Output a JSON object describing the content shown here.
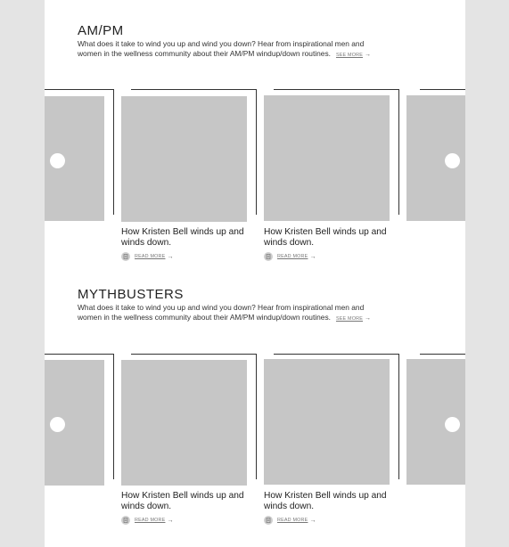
{
  "sections": [
    {
      "title": "AM/PM",
      "description": "What does it take to wind you up and wind you down? Hear from inspirational men and women in the wellness  community about their AM/PM windup/down routines.",
      "see_more_label": "SEE MORE",
      "see_more_arrow": "→",
      "cards": [
        {
          "title": "How Kristen Bell winds up and winds down.",
          "read_more_label": "READ MORE",
          "read_more_arrow": "→"
        },
        {
          "title": "How Kristen Bell winds up and winds down.",
          "read_more_label": "READ MORE",
          "read_more_arrow": "→"
        }
      ]
    },
    {
      "title": "MYTHBUSTERS",
      "description": "What does it take to wind you up and wind you down? Hear from inspirational men and women in the wellness  community about their AM/PM windup/down routines.",
      "see_more_label": "SEE MORE",
      "see_more_arrow": "→",
      "cards": [
        {
          "title": "How Kristen Bell winds up and winds down.",
          "read_more_label": "READ MORE",
          "read_more_arrow": "→"
        },
        {
          "title": "How Kristen Bell winds up and winds down.",
          "read_more_label": "READ MORE",
          "read_more_arrow": "→"
        }
      ]
    }
  ],
  "colors": {
    "page_bg": "#ffffff",
    "outer_bg": "#e4e4e4",
    "image_placeholder": "#c6c6c6",
    "frame_line": "#333333"
  },
  "icons": {
    "read_more": "bookmark-icon",
    "prev": "carousel-prev-icon",
    "next": "carousel-next-icon"
  }
}
